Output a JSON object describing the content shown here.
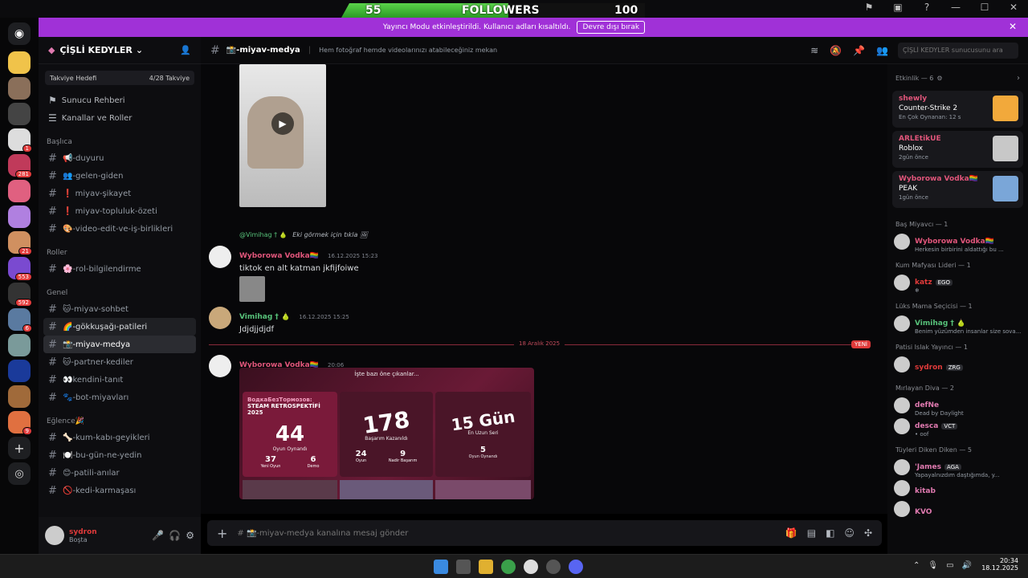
{
  "overlay": {
    "followers_count": "55",
    "followers_label": "FOLLOWERS",
    "followers_goal": "100",
    "followers_progress": 0.55
  },
  "streamer": {
    "message": "Yayıncı Modu etkinleştirildi. Kullanıcı adları kısaltıldı.",
    "button": "Devre dışı bırak"
  },
  "server": {
    "name": "ÇİŞLİ KEDYLER",
    "boost_label": "Takviye Hedefi",
    "boost_count": "4/28 Takviye"
  },
  "nav": {
    "guide": "Sunucu Rehberi",
    "roles": "Kanallar ve Roller"
  },
  "categories": {
    "main": "Başlıca",
    "roles": "Roller",
    "general": "Genel",
    "fun": "Eğlence🎉"
  },
  "channels": {
    "main": [
      "📢-duyuru",
      "👥-gelen-giden",
      "❗ miyav-şikayet",
      "❗ miyav-topluluk-özeti",
      "🎨-video-edit-ve-iş-birlikleri"
    ],
    "roles": [
      "🌸-rol-bilgilendirme"
    ],
    "general": [
      "🐱-miyav-sohbet",
      "🌈-gökkuşağı-patileri",
      "📸-miyav-medya",
      "🐱-partner-kediler",
      "👀kendini-tanıt",
      "🐾-bot-miyavları"
    ],
    "fun": [
      "🦴-kum-kabı-geyikleri",
      "🍽️-bu-gün-ne-yedin",
      "😊-patili-anılar",
      "🚫-kedi-karmaşası"
    ]
  },
  "user": {
    "name": "sydron",
    "status": "Boşta"
  },
  "topbar": {
    "channel": "📸-miyav-medya",
    "topic": "Hem fotoğraf hemde videolarınızı atabileceğiniz mekan",
    "search_placeholder": "ÇİŞLİ KEDYLER sunucusunu ara"
  },
  "messages": {
    "reply_user": "@Vimihag † 🍐",
    "reply_text": "Eki görmek için tıkla",
    "m1_user": "Wyborowa Vodka🏳️‍🌈",
    "m1_time": "16.12.2025 15:23",
    "m1_text": "tiktok en alt katman jkfijfoiwe",
    "m2_user": "Vimihag † 🍐",
    "m2_time": "16.12.2025 15:25",
    "m2_text": "Jdjdjjdjdf",
    "divider": "18 Aralık 2025",
    "new_badge": "YENİ",
    "m3_user": "Wyborowa Vodka🏳️‍🌈",
    "m3_time": "20:06",
    "card_header": "İşte bazı öne çıkanlar...",
    "card_title1": "ВодкаБезТормозов:",
    "card_title2": "STEAM RETROSPEKTİFİ",
    "card_year": "2025",
    "games_num": "44",
    "games_label": "Oyun Oynandı",
    "new_games": "37",
    "new_games_label": "Yeni Oyun",
    "demo": "6",
    "demo_label": "Demo",
    "ach_num": "178",
    "ach_label": "Başarım Kazanıldı",
    "ach_a": "24",
    "ach_a_label": "Oyun",
    "ach_b": "9",
    "ach_b_label": "Nadir Başarım",
    "streak_num": "15 Gün",
    "streak_label": "En Uzun Seri",
    "streak_games": "5",
    "streak_games_label": "Oyun Oynandı"
  },
  "composer": {
    "placeholder": "# 📸-miyav-medya kanalına mesaj gönder"
  },
  "activity": {
    "header": "Etkinlik — 6",
    "cards": [
      {
        "user": "shewly",
        "game": "Counter-Strike 2",
        "sub": "En Çok Oynanan: 12 s",
        "color": "#f2a93b"
      },
      {
        "user": "ARLEtikUE",
        "game": "Roblox",
        "sub": "2gün önce",
        "color": "#c8c8c8"
      },
      {
        "user": "Wyborowa Vodka🏳️‍🌈",
        "game": "PEAK",
        "sub": "1gün önce",
        "color": "#7aa6d8"
      }
    ]
  },
  "member_groups": [
    {
      "title": "Baş Miyavcı — 1",
      "members": [
        {
          "name": "Wyborowa Vodka🏳️‍🌈",
          "sub": "Herkesin birbirini aldattığı bu ...",
          "color": "#e0557a"
        }
      ]
    },
    {
      "title": "Kum Mafyası Lideri — 1",
      "members": [
        {
          "name": "katz",
          "tag": "EGO",
          "sub": "❄",
          "color": "#e03a3a"
        }
      ]
    },
    {
      "title": "Lüks Mama Seçicisi — 1",
      "members": [
        {
          "name": "Vimihag † 🍐",
          "sub": "Benim yüzümden insanlar size sova...",
          "color": "#57c27a"
        }
      ]
    },
    {
      "title": "Patisi Islak Yayıncı — 1",
      "members": [
        {
          "name": "sydron",
          "tag": "ZRG",
          "sub": "",
          "color": "#e03a3a"
        }
      ]
    },
    {
      "title": "Mırlayan Diva — 2",
      "members": [
        {
          "name": "defNe",
          "sub": "Dead by Daylight",
          "color": "#e07ab0"
        },
        {
          "name": "desca",
          "tag": "VCT",
          "sub": "• oof",
          "color": "#e07ab0"
        }
      ]
    },
    {
      "title": "Tüyleri Diken Diken — 5",
      "members": [
        {
          "name": "'James",
          "tag": "AGA",
          "sub": "Yapayalnızdım daştığımda, y...",
          "color": "#e07ab0"
        },
        {
          "name": "kitab",
          "sub": "",
          "color": "#e07ab0"
        },
        {
          "name": "KVO",
          "sub": "",
          "color": "#e07ab0"
        }
      ]
    }
  ],
  "taskbar": {
    "time": "20:34",
    "date": "18.12.2025"
  }
}
